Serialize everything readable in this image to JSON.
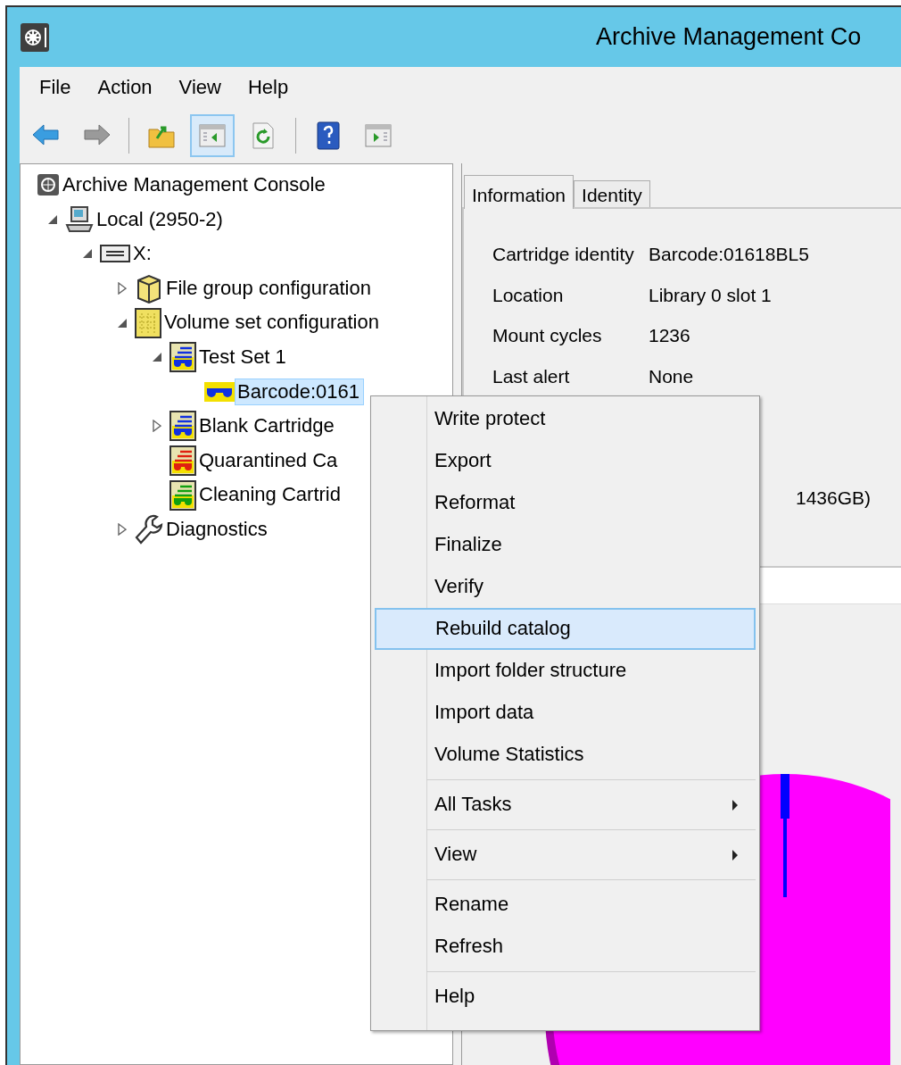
{
  "window": {
    "title": "Archive Management Co"
  },
  "menu_bar": [
    {
      "label": "File"
    },
    {
      "label": "Action"
    },
    {
      "label": "View"
    },
    {
      "label": "Help"
    }
  ],
  "toolbar": [
    {
      "kind": "back",
      "pressed": false
    },
    {
      "kind": "forward",
      "pressed": false
    },
    {
      "kind": "separator"
    },
    {
      "kind": "up",
      "pressed": false
    },
    {
      "kind": "tree",
      "pressed": true
    },
    {
      "kind": "refresh",
      "pressed": false
    },
    {
      "kind": "separator"
    },
    {
      "kind": "help",
      "pressed": false
    },
    {
      "kind": "pane",
      "pressed": false
    }
  ],
  "tree": {
    "label": "Archive Management Console",
    "kind": "console",
    "selected": false,
    "children": [
      {
        "label": "Local (2950-2)",
        "kind": "computer",
        "expanded": true,
        "selected": false,
        "children": [
          {
            "label": "X:",
            "kind": "drive",
            "expanded": true,
            "selected": false,
            "children": [
              {
                "label": "File group configuration",
                "kind": "filegroup",
                "expanded": false,
                "selected": false
              },
              {
                "label": "Volume set configuration",
                "kind": "volumeset",
                "expanded": true,
                "selected": false,
                "children": [
                  {
                    "label": "Test Set 1",
                    "kind": "set",
                    "expanded": true,
                    "selected": false,
                    "children": [
                      {
                        "label": "Barcode:0161",
                        "kind": "cartridge",
                        "selected": true
                      }
                    ]
                  },
                  {
                    "label": "Blank Cartridge",
                    "kind": "set",
                    "expanded": false,
                    "selected": false
                  },
                  {
                    "label": "Quarantined Ca",
                    "kind": "quarantine",
                    "selected": false
                  },
                  {
                    "label": "Cleaning Cartrid",
                    "kind": "cleaning",
                    "selected": false
                  }
                ]
              },
              {
                "label": "Diagnostics",
                "kind": "wrench",
                "expanded": false,
                "selected": false
              }
            ]
          }
        ]
      }
    ]
  },
  "tabs": [
    {
      "label": "Information",
      "selected": true
    },
    {
      "label": "Identity",
      "selected": false
    }
  ],
  "info_rows": [
    {
      "kind": "pair",
      "label": "Cartridge identity",
      "value": "Barcode:01618BL5"
    },
    {
      "kind": "pair",
      "label": "Location",
      "value": "Library 0 slot 1"
    },
    {
      "kind": "pair",
      "label": "Mount cycles",
      "value": "1236"
    },
    {
      "kind": "pair",
      "label": "Last alert",
      "value": "None"
    },
    {
      "kind": "tail",
      "value": "1436GB)"
    }
  ],
  "context_menu": [
    {
      "kind": "item",
      "label": "Write protect",
      "selected": false
    },
    {
      "kind": "item",
      "label": "Export",
      "selected": false
    },
    {
      "kind": "item",
      "label": "Reformat",
      "selected": false
    },
    {
      "kind": "item",
      "label": "Finalize",
      "selected": false
    },
    {
      "kind": "item",
      "label": "Verify",
      "selected": false
    },
    {
      "kind": "item",
      "label": "Rebuild catalog",
      "selected": true
    },
    {
      "kind": "item",
      "label": "Import folder structure",
      "selected": false
    },
    {
      "kind": "item",
      "label": "Import data",
      "selected": false
    },
    {
      "kind": "item",
      "label": "Volume Statistics",
      "selected": false
    },
    {
      "kind": "separator"
    },
    {
      "kind": "submenu",
      "label": "All Tasks",
      "selected": false
    },
    {
      "kind": "separator"
    },
    {
      "kind": "submenu",
      "label": "View",
      "selected": false
    },
    {
      "kind": "separator"
    },
    {
      "kind": "item",
      "label": "Rename",
      "selected": false
    },
    {
      "kind": "item",
      "label": "Refresh",
      "selected": false
    },
    {
      "kind": "separator"
    },
    {
      "kind": "item",
      "label": "Help",
      "selected": false
    }
  ]
}
